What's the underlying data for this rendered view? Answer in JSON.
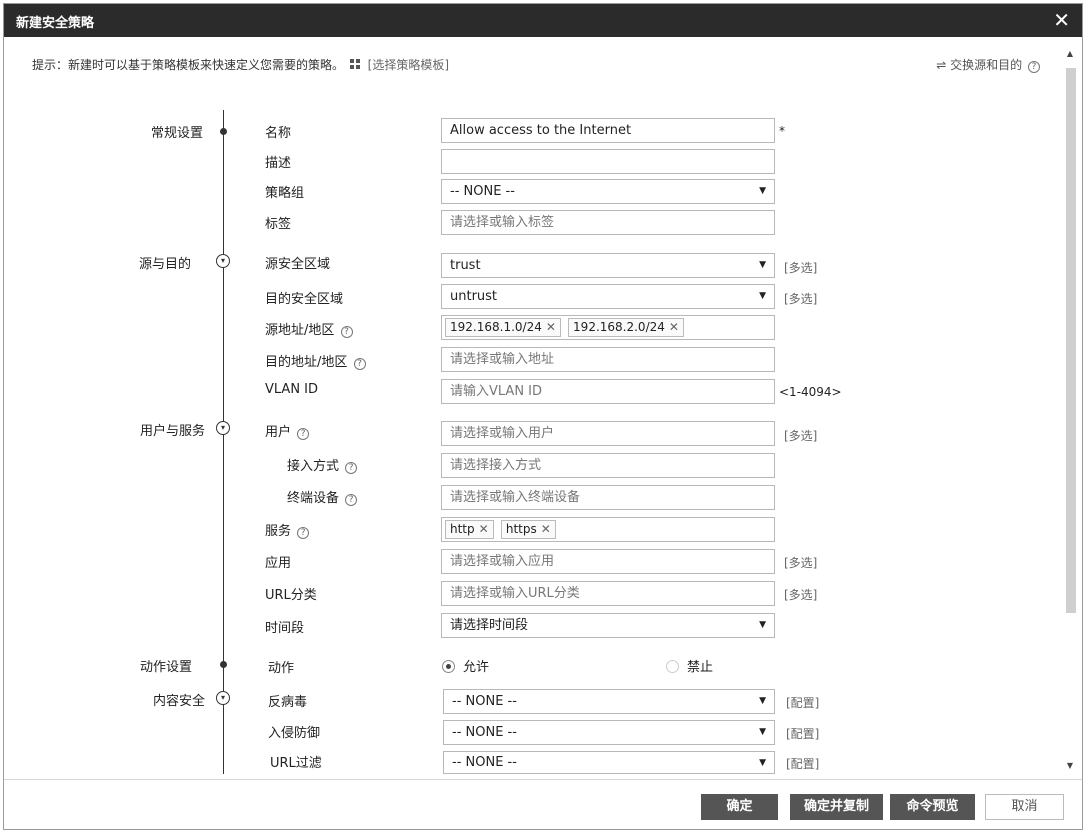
{
  "dialog": {
    "title": "新建安全策略",
    "close_glyph": "✕"
  },
  "hint": {
    "text": "提示：新建时可以基于策略模板来快速定义您需要的策略。",
    "template_link": "[选择策略模板]"
  },
  "swap": {
    "label": "交换源和目的",
    "arrow_glyph": "⇌"
  },
  "sections": {
    "general": "常规设置",
    "src_dst": "源与目的",
    "user_service": "用户与服务",
    "action": "动作设置",
    "content": "内容安全"
  },
  "fields": {
    "name": {
      "label": "名称",
      "value": "Allow access to the Internet",
      "required": "*"
    },
    "desc": {
      "label": "描述",
      "value": ""
    },
    "policy_group": {
      "label": "策略组",
      "value": "-- NONE --"
    },
    "tag": {
      "label": "标签",
      "placeholder": "请选择或输入标签"
    },
    "src_zone": {
      "label": "源安全区域",
      "value": "trust",
      "side": "[多选]"
    },
    "dst_zone": {
      "label": "目的安全区域",
      "value": "untrust",
      "side": "[多选]"
    },
    "src_addr": {
      "label": "源地址/地区",
      "chips": [
        "192.168.1.0/24",
        "192.168.2.0/24"
      ]
    },
    "dst_addr": {
      "label": "目的地址/地区",
      "placeholder": "请选择或输入地址"
    },
    "vlan": {
      "label": "VLAN ID",
      "placeholder": "请输入VLAN ID",
      "range": "<1-4094>"
    },
    "user": {
      "label": "用户",
      "placeholder": "请选择或输入用户",
      "side": "[多选]"
    },
    "access_mode": {
      "label": "接入方式",
      "placeholder": "请选择接入方式"
    },
    "terminal": {
      "label": "终端设备",
      "placeholder": "请选择或输入终端设备"
    },
    "service": {
      "label": "服务",
      "chips": [
        "http",
        "https"
      ]
    },
    "app": {
      "label": "应用",
      "placeholder": "请选择或输入应用",
      "side": "[多选]"
    },
    "url_cat": {
      "label": "URL分类",
      "placeholder": "请选择或输入URL分类",
      "side": "[多选]"
    },
    "time": {
      "label": "时间段",
      "value": "请选择时间段"
    },
    "action": {
      "label": "动作",
      "allow": "允许",
      "deny": "禁止"
    },
    "antivirus": {
      "label": "反病毒",
      "value": "-- NONE --",
      "side": "[配置]"
    },
    "ips": {
      "label": "入侵防御",
      "value": "-- NONE --",
      "side": "[配置]"
    },
    "url_filter": {
      "label": "URL过滤",
      "value": "-- NONE --",
      "side": "[配置]"
    }
  },
  "buttons": {
    "ok": "确定",
    "ok_copy": "确定并复制",
    "cmd_preview": "命令预览",
    "cancel": "取消"
  },
  "glyphs": {
    "caret": "▼",
    "chip_close": "✕",
    "question": "?",
    "circle_down": "▾",
    "scroll_up": "▲",
    "scroll_down": "▼"
  }
}
